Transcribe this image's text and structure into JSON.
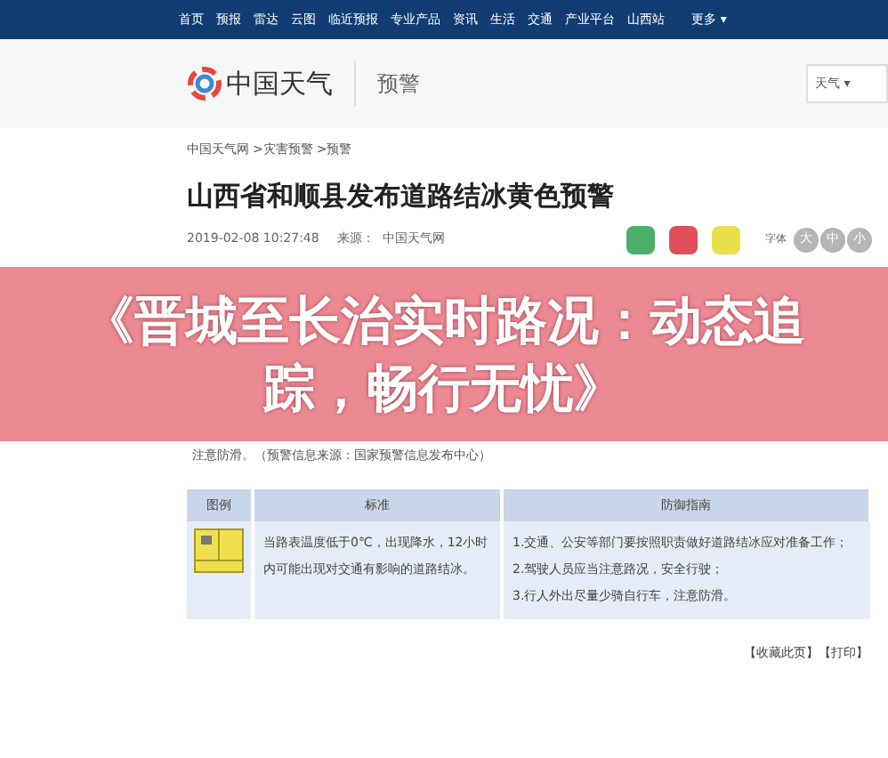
{
  "nav": {
    "items": [
      "首页",
      "预报",
      "雷达",
      "云图",
      "临近预报",
      "专业产品",
      "资讯",
      "生活",
      "交通",
      "产业平台",
      "山西站"
    ],
    "more": "更多 ▾"
  },
  "header": {
    "logo_text": "中国天气",
    "section": "预警",
    "search_select": "天气 ▾"
  },
  "breadcrumb": [
    "中国天气网",
    ">灾害预警",
    ">预警"
  ],
  "article": {
    "title": "山西省和顺县发布道路结冰黄色预警",
    "date": "2019-02-08 10:27:48",
    "source": "来源：  中国天气网",
    "font_label": "字体",
    "font_sizes": [
      {
        "label": "大",
        "selected": false
      },
      {
        "label": "中",
        "selected": false
      },
      {
        "label": "小",
        "selected": false
      }
    ],
    "body_tail": "注意防滑。（预警信息来源：国家预警信息发布中心）"
  },
  "overlay_title": "《晋城至长治实时路况：动态追踪，畅行无忧》",
  "table": {
    "columns": [
      "图例",
      "标准",
      "防御指南"
    ],
    "rows": [
      {
        "standard": "当路表温度低于0℃，出现降水，12小时内可能出现对交通有影响的道路结冰。",
        "guide": [
          "1.交通、公安等部门要按照职责做好道路结冰应对准备工作；",
          "2.驾驶人员应当注意路况，安全行驶；",
          "3.行人外出尽量少骑自行车，注意防滑。"
        ]
      }
    ]
  },
  "footer_links": [
    "【收藏此页】",
    "【打印】"
  ]
}
